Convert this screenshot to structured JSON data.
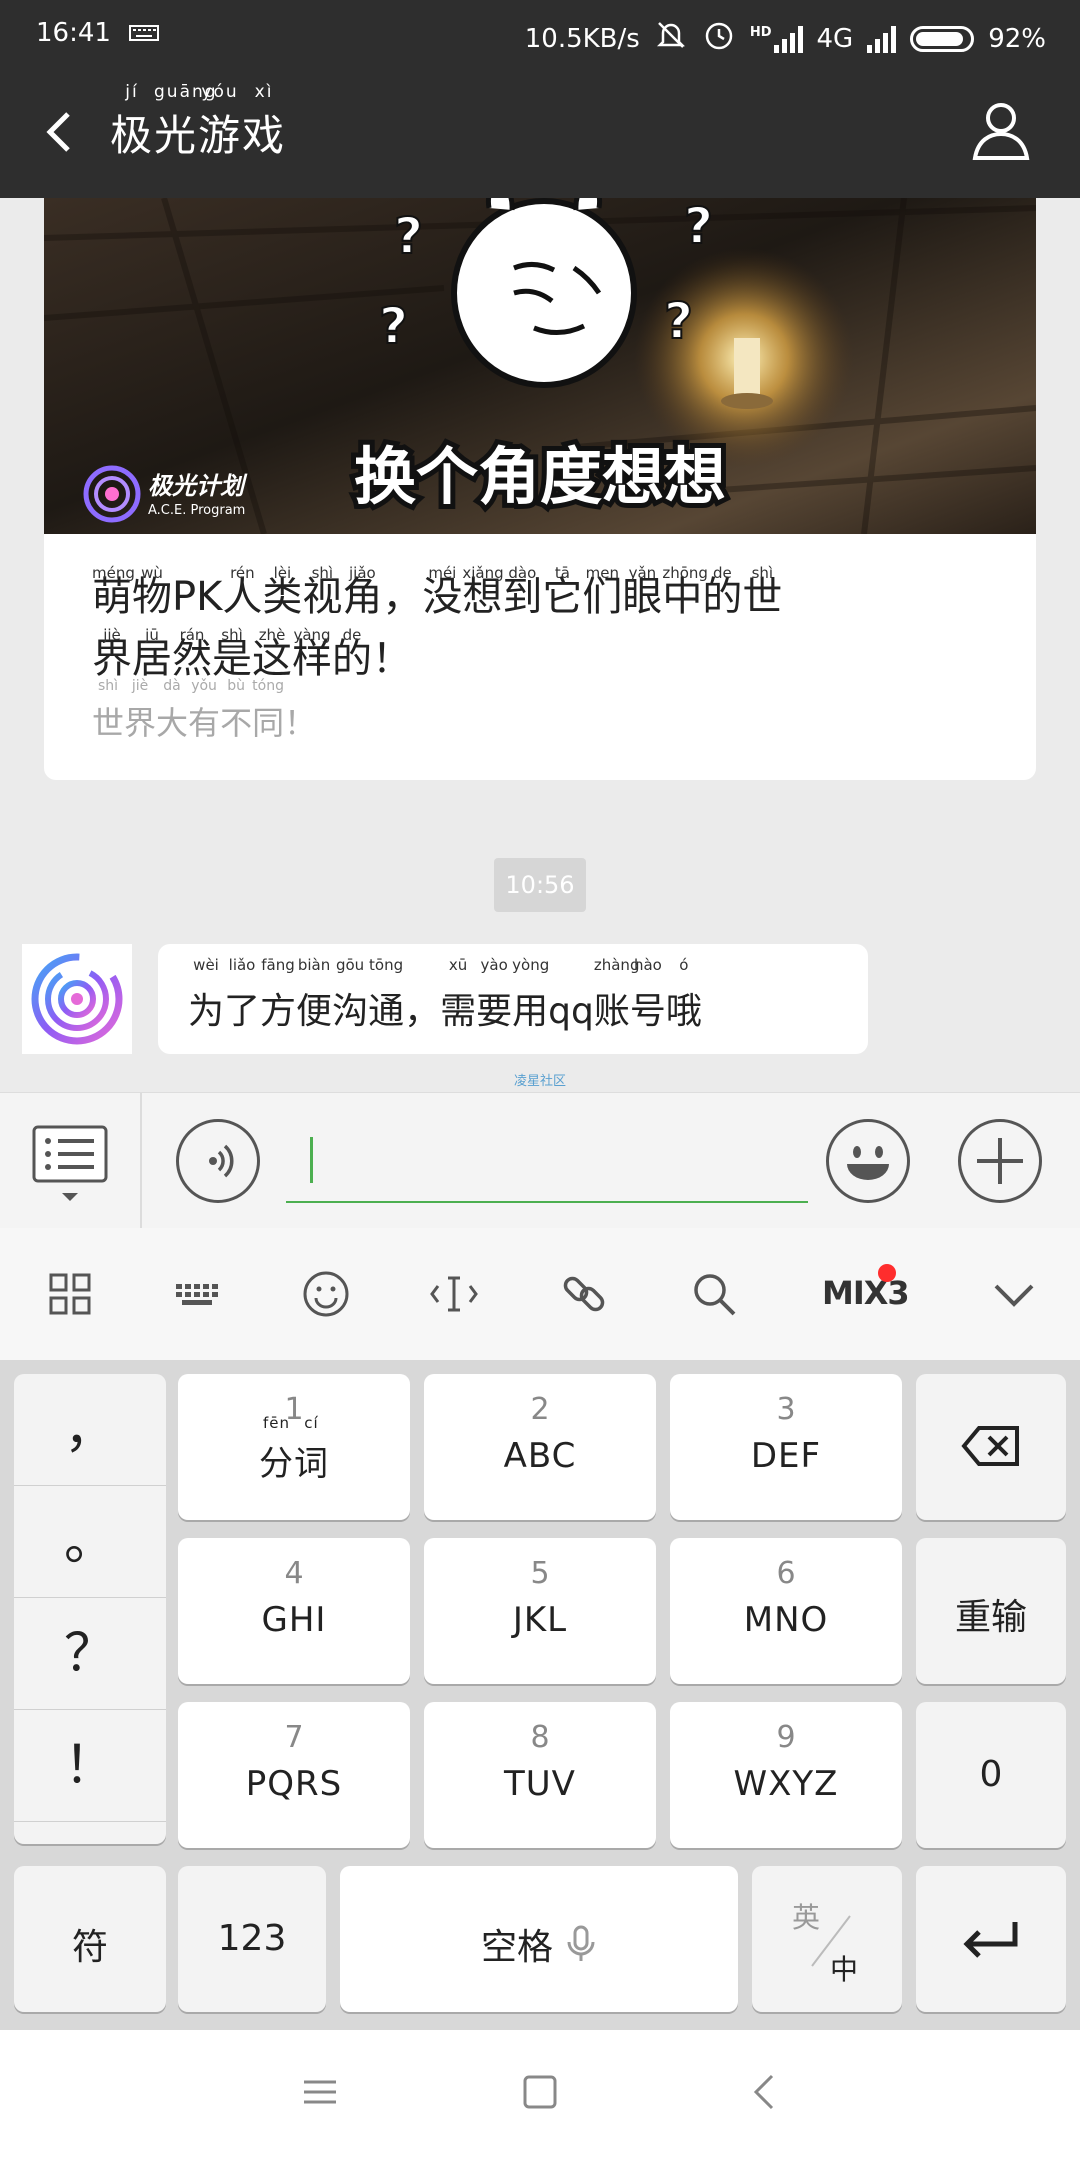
{
  "status_bar": {
    "time": "16:41",
    "net_speed": "10.5KB/s",
    "hd_label": "HD",
    "network_type": "4G",
    "battery": "92%"
  },
  "header": {
    "title_chars": [
      {
        "char": "极",
        "pinyin": "jí"
      },
      {
        "char": "光",
        "pinyin": "guāng"
      },
      {
        "char": "游",
        "pinyin": "yóu"
      },
      {
        "char": "戏",
        "pinyin": "xì"
      }
    ]
  },
  "article": {
    "image_caption": "换个角度想想",
    "brand_name": "极光计划",
    "brand_sub": "A.C.E. Program",
    "title_line1": [
      {
        "char": "萌",
        "pinyin": "méng"
      },
      {
        "char": "物",
        "pinyin": "wù"
      },
      {
        "char": "PK",
        "pinyin": ""
      },
      {
        "char": "人",
        "pinyin": "rén"
      },
      {
        "char": "类",
        "pinyin": "lèi"
      },
      {
        "char": "视",
        "pinyin": "shì"
      },
      {
        "char": "角",
        "pinyin": "jiǎo"
      },
      {
        "char": "，",
        "pinyin": ""
      },
      {
        "char": "没",
        "pinyin": "méi"
      },
      {
        "char": "想",
        "pinyin": "xiǎng"
      },
      {
        "char": "到",
        "pinyin": "dào"
      },
      {
        "char": "它",
        "pinyin": "tā"
      },
      {
        "char": "们",
        "pinyin": "men"
      },
      {
        "char": "眼",
        "pinyin": "yǎn"
      },
      {
        "char": "中",
        "pinyin": "zhōng"
      },
      {
        "char": "的",
        "pinyin": "de"
      },
      {
        "char": "世",
        "pinyin": "shì"
      }
    ],
    "title_line2": [
      {
        "char": "界",
        "pinyin": "jiè"
      },
      {
        "char": "居",
        "pinyin": "jū"
      },
      {
        "char": "然",
        "pinyin": "rán"
      },
      {
        "char": "是",
        "pinyin": "shì"
      },
      {
        "char": "这",
        "pinyin": "zhè"
      },
      {
        "char": "样",
        "pinyin": "yàng"
      },
      {
        "char": "的",
        "pinyin": "de"
      },
      {
        "char": "！",
        "pinyin": ""
      }
    ],
    "subtitle": [
      {
        "char": "世",
        "pinyin": "shì"
      },
      {
        "char": "界",
        "pinyin": "jiè"
      },
      {
        "char": "大",
        "pinyin": "dà"
      },
      {
        "char": "有",
        "pinyin": "yǒu"
      },
      {
        "char": "不",
        "pinyin": "bù"
      },
      {
        "char": "同",
        "pinyin": "tóng"
      },
      {
        "char": "！",
        "pinyin": ""
      }
    ]
  },
  "chat": {
    "timestamp": "10:56",
    "message": [
      {
        "char": "为",
        "pinyin": "wèi"
      },
      {
        "char": "了",
        "pinyin": "liǎo"
      },
      {
        "char": "方",
        "pinyin": "fāng"
      },
      {
        "char": "便",
        "pinyin": "biàn"
      },
      {
        "char": "沟",
        "pinyin": "gōu"
      },
      {
        "char": "通",
        "pinyin": "tōng"
      },
      {
        "char": "，",
        "pinyin": ""
      },
      {
        "char": "需",
        "pinyin": "xū"
      },
      {
        "char": "要",
        "pinyin": "yào"
      },
      {
        "char": "用",
        "pinyin": "yòng"
      },
      {
        "char": " qq ",
        "pinyin": ""
      },
      {
        "char": "账",
        "pinyin": "zhàng"
      },
      {
        "char": "号",
        "pinyin": "hào"
      },
      {
        "char": "哦",
        "pinyin": "ó"
      }
    ],
    "source_label": "凌星社区"
  },
  "input_bar": {
    "value": ""
  },
  "ime_toolbar": {
    "brand": "MIX3"
  },
  "keyboard": {
    "punct": [
      "，",
      "。",
      "？",
      "！"
    ],
    "keys": [
      {
        "num": "1",
        "label": "分词",
        "pinyin": [
          "fēn",
          "cí"
        ]
      },
      {
        "num": "2",
        "label": "ABC"
      },
      {
        "num": "3",
        "label": "DEF"
      },
      {
        "num": "4",
        "label": "GHI"
      },
      {
        "num": "5",
        "label": "JKL"
      },
      {
        "num": "6",
        "label": "MNO"
      },
      {
        "num": "7",
        "label": "PQRS"
      },
      {
        "num": "8",
        "label": "TUV"
      },
      {
        "num": "9",
        "label": "WXYZ"
      }
    ],
    "reinput_label": "重输",
    "zero_label": "0",
    "symbol_label": "符",
    "numeric_label": "123",
    "space_label": "空格",
    "lang_en": "英",
    "lang_zh": "中"
  },
  "colors": {
    "header_bg": "#2e2e2e",
    "input_accent": "#4caf50",
    "badge_dot": "#ff2d2d",
    "page_bg": "#ebebeb"
  }
}
